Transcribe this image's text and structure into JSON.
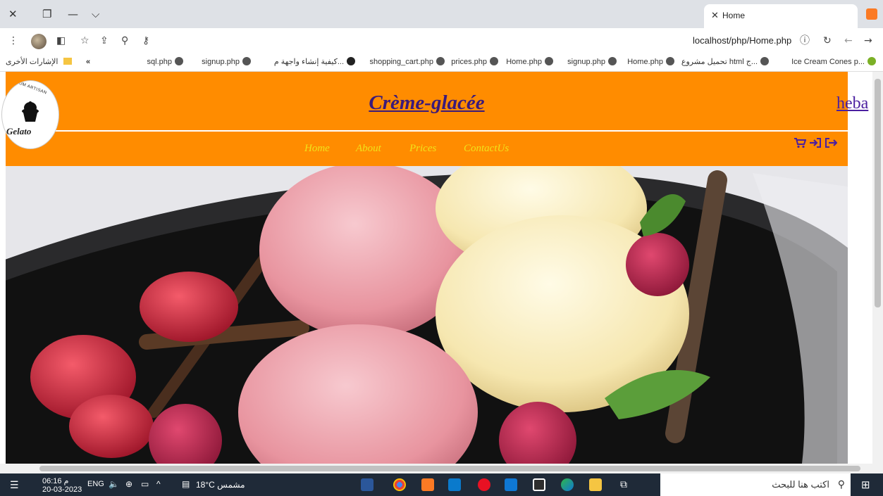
{
  "browser": {
    "active_tab_title": "Home",
    "url": "localhost/php/Home.php",
    "bookmarks": [
      "Ice Cream Cones p...",
      "تحميل مشروع html ج...",
      "Home.php",
      "signup.php",
      "Home.php",
      "prices.php",
      "shopping_cart.php",
      "كيفية إنشاء واجهة م...",
      "signup.php",
      "sql.php"
    ],
    "bookmarks_more": "«",
    "other_bookmarks": "الإشارات الأخرى"
  },
  "site": {
    "title": "Crème-glacée",
    "user": "heba",
    "logo_text": "Gelato",
    "logo_arc_text": "PREMIUM ARTISAN",
    "nav": [
      "Home",
      "About",
      "Prices",
      "ContactUs"
    ]
  },
  "taskbar": {
    "time": "06:16 م",
    "date": "20-03-2023",
    "lang": "ENG",
    "weather": "18°C  مشمس",
    "search_placeholder": "اكتب هنا للبحث"
  },
  "icons": {
    "cart": "shopping-cart-icon",
    "login": "sign-in-icon",
    "logout": "sign-out-icon"
  },
  "colors": {
    "header_bg": "#ff8c00",
    "nav_link": "#f1e21a",
    "title": "#3b1a7a"
  }
}
